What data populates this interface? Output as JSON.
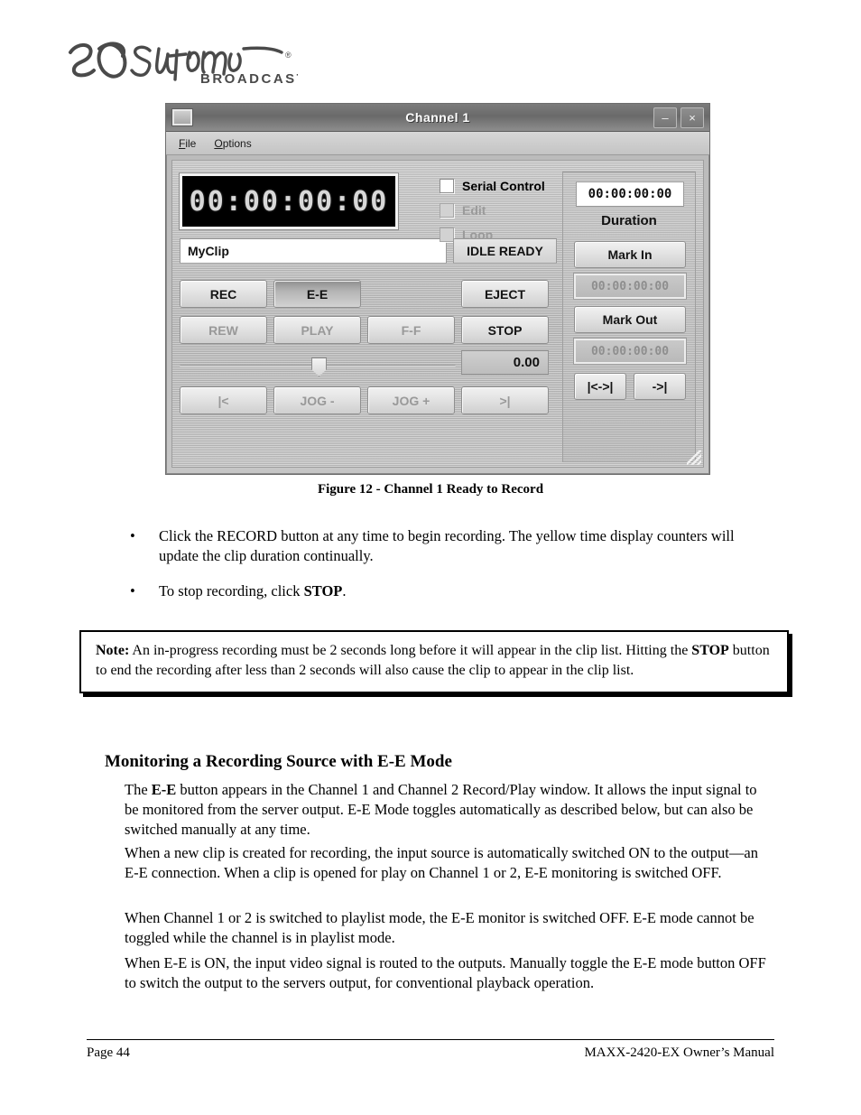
{
  "logo": {
    "brand": "360 Systems",
    "sub": "BROADCAST",
    "registered": "®"
  },
  "window": {
    "title": "Channel  1",
    "sysmenu_icon": "system-menu-icon",
    "minimize_label": "–",
    "close_label": "×",
    "menus": [
      {
        "mnemonic": "F",
        "rest": "ile"
      },
      {
        "mnemonic": "O",
        "rest": "ptions"
      }
    ],
    "led_time": "00:00:00:00",
    "clip_name": "MyClip",
    "checkboxes": [
      {
        "label": "Serial Control",
        "checked": false,
        "enabled": true
      },
      {
        "label": "Edit",
        "checked": false,
        "enabled": false
      },
      {
        "label": "Loop",
        "checked": false,
        "enabled": false
      }
    ],
    "status": "IDLE READY",
    "transport": {
      "rec": "REC",
      "ee": "E-E",
      "eject": "EJECT",
      "rew": "REW",
      "play": "PLAY",
      "ff": "F-F",
      "stop": "STOP",
      "cue_start": "|<",
      "jog_minus": "JOG -",
      "jog_plus": "JOG +",
      "cue_end": ">|"
    },
    "speed_value": "0.00",
    "right_panel": {
      "duration_value": "00:00:00:00",
      "duration_label": "Duration",
      "mark_in": "Mark In",
      "mark_in_tc": "00:00:00:00",
      "mark_out": "Mark Out",
      "mark_out_tc": "00:00:00:00",
      "nav_both": "|<->|",
      "nav_out": "->|"
    }
  },
  "document": {
    "figure_caption": "Figure 12 - Channel 1 Ready to Record",
    "bullets": [
      {
        "marker": "•",
        "text": "Click the RECORD button at any time to begin recording. The yellow time display counters will update the clip duration continually."
      },
      {
        "marker": "•",
        "text_pre": "To stop recording, click ",
        "bold": "STOP",
        "text_post": "."
      }
    ],
    "note": {
      "label": "Note:",
      "part1": " An in-progress recording must be 2 seconds long before it will appear in the clip list. Hitting the ",
      "bold": "STOP",
      "part2": " button to end the recording after less than 2 seconds will also cause the clip to appear in the clip list."
    },
    "section_heading": "Monitoring a Recording Source with E-E Mode",
    "paragraphs": [
      {
        "pre": "The ",
        "bold": "E-E",
        "post": " button appears in the Channel 1 and Channel 2 Record/Play window. It allows the input signal to be monitored from the server output.  E-E Mode toggles automatically as described below, but can also be switched manually at any time."
      },
      {
        "text": "When a new clip is created for recording, the input source is automatically switched ON to the output—an E-E connection.  When a clip is opened for play on Channel 1 or 2, E-E monitoring is switched OFF."
      },
      {
        "text": "When Channel 1 or 2 is switched to playlist mode, the E-E monitor is switched OFF.  E-E mode cannot be toggled while the channel is in playlist mode."
      },
      {
        "text": "When E-E is ON, the input video signal is routed to the outputs.  Manually toggle the E-E mode button OFF to switch the output to the servers output, for conventional playback operation."
      }
    ],
    "footer_left": "Page 44",
    "footer_right": "MAXX-2420-EX Owner’s Manual"
  }
}
